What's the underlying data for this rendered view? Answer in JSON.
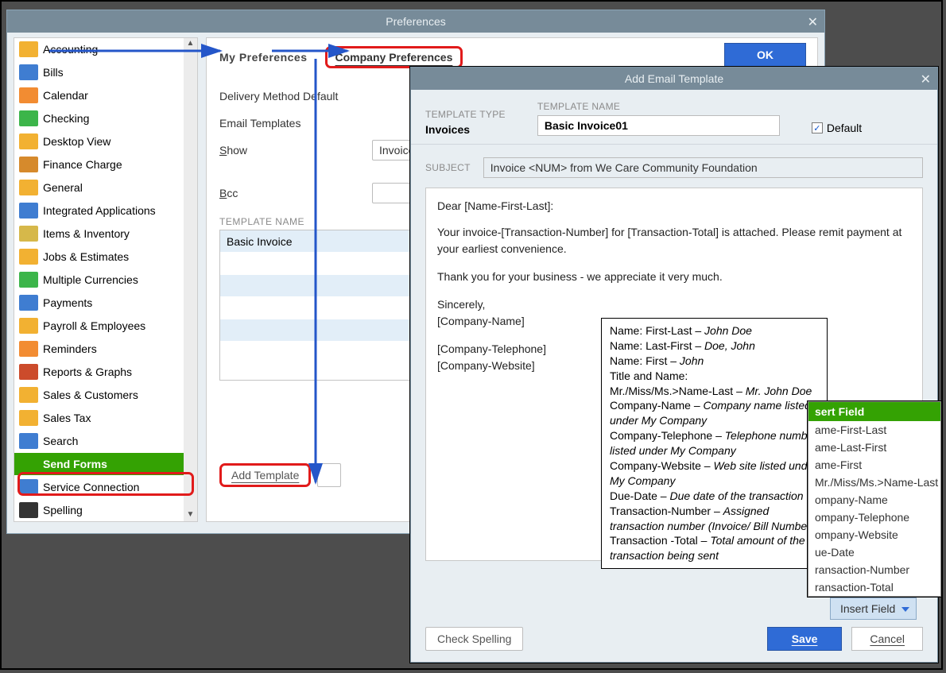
{
  "prefs": {
    "title": "Preferences",
    "ok": "OK",
    "tabs": {
      "tab1": "My Preferences",
      "tab2": "Company Preferences"
    },
    "labels": {
      "delivery": "Delivery Method Default",
      "templates": "Email Templates",
      "show": "Show",
      "bcc": "Bcc",
      "tmplhead": "TEMPLATE NAME",
      "add": "Add Template"
    },
    "show_value": "Invoices",
    "tmpl_rows": [
      "Basic Invoice",
      "",
      "",
      "",
      "",
      ""
    ],
    "sidebar": [
      "Accounting",
      "Bills",
      "Calendar",
      "Checking",
      "Desktop View",
      "Finance Charge",
      "General",
      "Integrated Applications",
      "Items & Inventory",
      "Jobs & Estimates",
      "Multiple Currencies",
      "Payments",
      "Payroll & Employees",
      "Reminders",
      "Reports & Graphs",
      "Sales & Customers",
      "Sales Tax",
      "Search",
      "Send Forms",
      "Service Connection",
      "Spelling"
    ],
    "active_index": 18
  },
  "aet": {
    "title": "Add Email Template",
    "labels": {
      "type": "TEMPLATE TYPE",
      "name": "TEMPLATE NAME",
      "default": "Default",
      "subject": "SUBJECT"
    },
    "type_value": "Invoices",
    "name_value": "Basic Invoice01",
    "default_checked": true,
    "subject_value": "Invoice <NUM> from We Care Community Foundation",
    "body": {
      "dear": "Dear [Name-First-Last]:",
      "para1": "Your invoice-[Transaction-Number] for [Transaction-Total] is attached. Please remit payment at your earliest convenience.",
      "para2": "Thank you for your business - we appreciate it very much.",
      "closing": "Sincerely,",
      "company": "[Company-Name]",
      "tel": "[Company-Telephone]",
      "web": "[Company-Website]"
    },
    "check_spelling": "Check Spelling",
    "insert_field_btn": "Insert Field",
    "save": "Save",
    "cancel": "Cancel",
    "insert_menu": {
      "head": "sert Field",
      "items": [
        "ame-First-Last",
        "ame-Last-First",
        "ame-First",
        "Mr./Miss/Ms.>Name-Last",
        "ompany-Name",
        "ompany-Telephone",
        "ompany-Website",
        "ue-Date",
        "ransaction-Number",
        "ransaction-Total"
      ]
    }
  },
  "defs": [
    [
      "Name: First-Last – ",
      "John Doe"
    ],
    [
      "Name: Last-First – ",
      "Doe, John"
    ],
    [
      "Name: First – ",
      "John"
    ],
    [
      "Title and Name:",
      ""
    ],
    [
      "Mr./Miss/Ms.>Name-Last – ",
      "Mr. John Doe"
    ],
    [
      "Company-Name – ",
      "Company name listed under My Company"
    ],
    [
      "Company-Telephone – ",
      "Telephone number listed under My Company"
    ],
    [
      "Company-Website – ",
      "Web site listed under My Company"
    ],
    [
      "Due-Date – ",
      "Due date of the transaction"
    ],
    [
      "Transaction-Number – ",
      "Assigned transaction number (Invoice/ Bill Number)"
    ],
    [
      "Transaction -Total – ",
      "Total amount of the transaction being sent"
    ]
  ]
}
